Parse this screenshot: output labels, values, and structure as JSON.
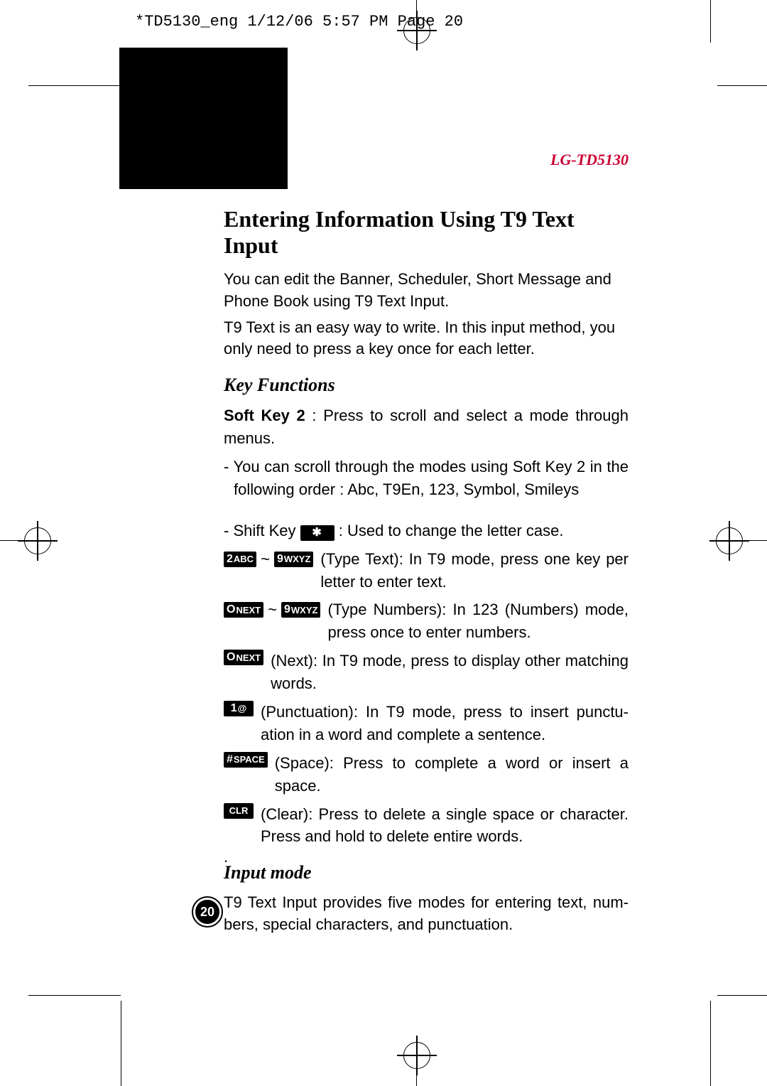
{
  "slug": "*TD5130_eng  1/12/06  5:57 PM  Page 20",
  "model": "LG-TD5130",
  "title": "Entering Information Using T9 Text Input",
  "intro1": "You can edit the Banner, Scheduler, Short Message and Phone Book using T9 Text Input.",
  "intro2": "T9 Text is an easy way to write. In this input method, you only need to press a key once for each letter.",
  "h_keyfunc": "Key Functions",
  "softkey_lead": "Soft Key 2",
  "softkey_rest": " : Press to scroll and select a mode through menus.",
  "softkey_sub": "- You can scroll through the modes using Soft Key 2 in the following order : Abc, T9En, 123, Symbol, Smileys",
  "shift_pre": "- Shift Key ",
  "shift_post": " : Used to change the letter case.",
  "typetext": "(Type Text): In T9 mode, press one key  per letter  to enter text.",
  "typenum": "(Type Numbers): In 123 (Numbers) mode, press once to enter numbers.",
  "next": "(Next): In T9 mode, press to display other matching words.",
  "punct": "(Punctuation): In T9 mode, press to insert punctu­ation in a  word and complete a sentence.",
  "space": "(Space): Press to complete a word or insert a space.",
  "clear": "(Clear): Press to delete a single space or charac­ter. Press and hold to delete entire words.",
  "h_inputmode": "Input mode",
  "inputmode_p": "T9 Text Input provides five modes for entering text, num­bers, special characters, and punctuation.",
  "bullet": ".",
  "page_number": "20",
  "keys": {
    "star": "✱",
    "two": "2",
    "two_sub": "ABC",
    "nine": "9",
    "nine_sub": "WXYZ",
    "zero": "O",
    "zero_sub": "NEXT",
    "one": "1",
    "one_sub": "@",
    "hash": "#",
    "hash_sub": "SPACE",
    "clr": "CLR"
  }
}
